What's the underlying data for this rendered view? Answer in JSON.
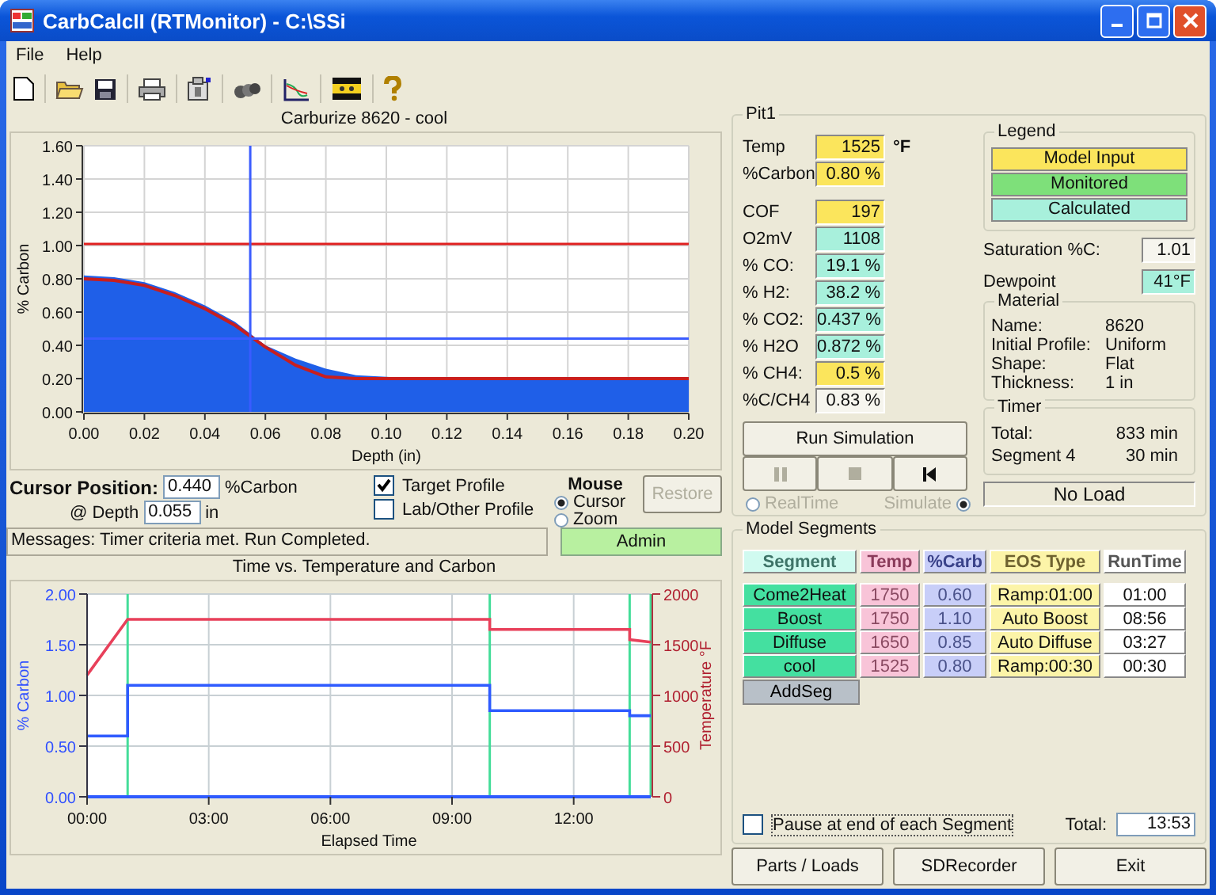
{
  "window": {
    "title": "CarbCalcII (RTMonitor) - C:\\SSi"
  },
  "menu": [
    "File",
    "Help"
  ],
  "profile_chart": {
    "title": "Carburize 8620 - cool",
    "chart_data": {
      "type": "area",
      "xlabel": "Depth (in)",
      "ylabel": "% Carbon",
      "xlim": [
        0,
        0.2
      ],
      "ylim": [
        0,
        1.6
      ],
      "x": [
        0,
        0.01,
        0.02,
        0.03,
        0.04,
        0.05,
        0.06,
        0.07,
        0.08,
        0.09,
        0.1,
        0.11,
        0.12,
        0.13,
        0.14,
        0.15,
        0.16,
        0.17,
        0.18,
        0.19,
        0.2
      ],
      "series": [
        {
          "type": "area",
          "color": "#1f5fe8",
          "values": [
            0.82,
            0.81,
            0.78,
            0.72,
            0.64,
            0.54,
            0.4,
            0.32,
            0.26,
            0.22,
            0.21,
            0.2,
            0.2,
            0.2,
            0.2,
            0.2,
            0.2,
            0.2,
            0.2,
            0.2,
            0.2
          ]
        },
        {
          "type": "line",
          "color": "#c81e1e",
          "values": [
            0.8,
            0.79,
            0.76,
            0.7,
            0.62,
            0.52,
            0.39,
            0.28,
            0.21,
            0.2,
            0.2,
            0.2,
            0.2,
            0.2,
            0.2,
            0.2,
            0.2,
            0.2,
            0.2,
            0.2,
            0.2
          ]
        }
      ],
      "xticks": [
        {
          "value": 0,
          "label": "0.00"
        },
        {
          "value": 0.02,
          "label": "0.02"
        },
        {
          "value": 0.04,
          "label": "0.04"
        },
        {
          "value": 0.06,
          "label": "0.06"
        },
        {
          "value": 0.08,
          "label": "0.08"
        },
        {
          "value": 0.1,
          "label": "0.10"
        },
        {
          "value": 0.12,
          "label": "0.12"
        },
        {
          "value": 0.14,
          "label": "0.14"
        },
        {
          "value": 0.16,
          "label": "0.16"
        },
        {
          "value": 0.18,
          "label": "0.18"
        },
        {
          "value": 0.2,
          "label": "0.20"
        }
      ],
      "yticks": [
        {
          "value": 0,
          "label": "0.00"
        },
        {
          "value": 0.2,
          "label": "0.20"
        },
        {
          "value": 0.4,
          "label": "0.40"
        },
        {
          "value": 0.6,
          "label": "0.60"
        },
        {
          "value": 0.8,
          "label": "0.80"
        },
        {
          "value": 1,
          "label": "1.00"
        },
        {
          "value": 1.2,
          "label": "1.20"
        },
        {
          "value": 1.4,
          "label": "1.40"
        },
        {
          "value": 1.6,
          "label": "1.60"
        }
      ],
      "grid": true,
      "ref_lines": [
        {
          "axis": "y",
          "value": 1.01,
          "color": "#e02020"
        },
        {
          "axis": "y",
          "value": 0.44,
          "color": "#3a5cff"
        },
        {
          "axis": "x",
          "value": 0.055,
          "color": "#3a5cff"
        }
      ]
    }
  },
  "cursor": {
    "label": "Cursor Position:",
    "carbon": "0.440",
    "carbon_unit": "%Carbon",
    "depth_label": "@ Depth",
    "depth": "0.055",
    "depth_unit": "in"
  },
  "profiles": [
    {
      "label": "Target Profile",
      "checked": true
    },
    {
      "label": "Lab/Other Profile",
      "checked": false
    }
  ],
  "mouse": {
    "title": "Mouse",
    "options": [
      {
        "label": "Cursor",
        "selected": true
      },
      {
        "label": "Zoom",
        "selected": false
      }
    ]
  },
  "restore_button": {
    "label": "Restore",
    "disabled": true
  },
  "messages": "Messages: Timer criteria met.  Run Completed.",
  "user": "Admin",
  "time_chart": {
    "title": "Time vs. Temperature and Carbon",
    "chart_data": {
      "type": "line",
      "xlabel": "Elapsed Time",
      "ylabel": "% Carbon",
      "y2label": "Temperature °F",
      "xlim": [
        0,
        13.9
      ],
      "ylim": [
        0,
        2
      ],
      "y2lim": [
        0,
        2000
      ],
      "x": [
        0,
        1,
        1,
        9.93,
        9.93,
        13.38,
        13.38,
        13.9
      ],
      "series": [
        {
          "axis": "y2",
          "color": "#e8405a",
          "values": [
            1200,
            1750,
            1750,
            1750,
            1650,
            1650,
            1550,
            1525
          ]
        },
        {
          "color": "#2f5bff",
          "values": [
            0.6,
            0.6,
            1.1,
            1.1,
            0.85,
            0.85,
            0.8,
            0.8
          ]
        }
      ],
      "xticks": [
        {
          "value": 0,
          "label": "00:00"
        },
        {
          "value": 3,
          "label": "03:00"
        },
        {
          "value": 6,
          "label": "06:00"
        },
        {
          "value": 9,
          "label": "09:00"
        },
        {
          "value": 12,
          "label": "12:00"
        }
      ],
      "yticks": [
        {
          "value": 0,
          "label": "0.00"
        },
        {
          "value": 0.5,
          "label": "0.50"
        },
        {
          "value": 1,
          "label": "1.00"
        },
        {
          "value": 1.5,
          "label": "1.50"
        },
        {
          "value": 2,
          "label": "2.00"
        }
      ],
      "y2ticks": [
        0,
        500,
        1000,
        1500,
        2000
      ],
      "grid": true,
      "ref_lines": [
        {
          "axis": "x",
          "value": 1,
          "color": "#44dd99"
        },
        {
          "axis": "x",
          "value": 9.93,
          "color": "#44dd99"
        },
        {
          "axis": "x",
          "value": 13.38,
          "color": "#44dd99"
        },
        {
          "axis": "x",
          "value": 13.9,
          "color": "#44dd99"
        }
      ]
    }
  },
  "pit": {
    "title": "Pit1",
    "setpoints": [
      {
        "label": "Temp",
        "value": "1525",
        "unit": "°F",
        "kind": "input"
      },
      {
        "label": "%Carbon",
        "value": "0.80 %",
        "kind": "input"
      }
    ],
    "readings": [
      {
        "label": "COF",
        "value": "197",
        "kind": "input"
      },
      {
        "label": "O2mV",
        "value": "1108",
        "kind": "calculated"
      },
      {
        "label": "% CO:",
        "value": "19.1 %",
        "kind": "calculated"
      },
      {
        "label": "% H2:",
        "value": "38.2 %",
        "kind": "calculated"
      },
      {
        "label": "% CO2:",
        "value": "0.437 %",
        "kind": "calculated"
      },
      {
        "label": "% H2O",
        "value": "0.872 %",
        "kind": "calculated"
      },
      {
        "label": "% CH4:",
        "value": "0.5 %",
        "kind": "input"
      },
      {
        "label": "%C/CH4",
        "value": "0.83 %",
        "kind": "plain"
      }
    ]
  },
  "legend": {
    "title": "Legend",
    "items": [
      {
        "label": "Model Input",
        "kind": "input"
      },
      {
        "label": "Monitored",
        "kind": "monitored"
      },
      {
        "label": "Calculated",
        "kind": "calculated"
      }
    ]
  },
  "saturation": {
    "label": "Saturation %C:",
    "value": "1.01",
    "kind": "plain"
  },
  "dewpoint": {
    "label": "Dewpoint",
    "value": "41°F",
    "kind": "calculated"
  },
  "material": {
    "title": "Material",
    "rows": [
      {
        "label": "Name:",
        "value": "8620"
      },
      {
        "label": "Initial Profile:",
        "value": "Uniform"
      },
      {
        "label": "Shape:",
        "value": "Flat"
      },
      {
        "label": "Thickness:",
        "value": "1 in"
      }
    ]
  },
  "simulation": {
    "run_button": "Run Simulation",
    "controls": [
      {
        "kind": "pause",
        "disabled": true
      },
      {
        "kind": "stop",
        "disabled": true
      },
      {
        "kind": "rewind",
        "disabled": false
      }
    ],
    "modes": [
      {
        "label": "RealTime",
        "selected": false,
        "disabled": true
      },
      {
        "label": "Simulate",
        "selected": true,
        "disabled": true
      }
    ]
  },
  "timer": {
    "title": "Timer",
    "rows": [
      {
        "label": "Total:",
        "value": "833 min"
      },
      {
        "label": "Segment 4",
        "value": "30 min"
      }
    ]
  },
  "load_status": "No Load",
  "segments": {
    "title": "Model Segments",
    "columns": [
      {
        "label": "Segment",
        "kind": "name"
      },
      {
        "label": "Temp",
        "kind": "temp"
      },
      {
        "label": "%Carb",
        "kind": "carb"
      },
      {
        "label": "EOS Type",
        "kind": "eos"
      },
      {
        "label": "RunTime",
        "kind": "runtime"
      }
    ],
    "rows": [
      {
        "name": "Come2Heat",
        "temp": "1750",
        "carb": "0.60",
        "eos": "Ramp:01:00",
        "runtime": "01:00"
      },
      {
        "name": "Boost",
        "temp": "1750",
        "carb": "1.10",
        "eos": "Auto Boost",
        "runtime": "08:56"
      },
      {
        "name": "Diffuse",
        "temp": "1650",
        "carb": "0.85",
        "eos": "Auto Diffuse",
        "runtime": "03:27"
      },
      {
        "name": "cool",
        "temp": "1525",
        "carb": "0.80",
        "eos": "Ramp:00:30",
        "runtime": "00:30"
      }
    ],
    "add_button": "AddSeg",
    "pause": {
      "label": "Pause at end of each Segment",
      "checked": false
    },
    "total_label": "Total:",
    "total": "13:53"
  },
  "buttons": [
    "Parts / Loads",
    "SDRecorder",
    "Exit"
  ]
}
